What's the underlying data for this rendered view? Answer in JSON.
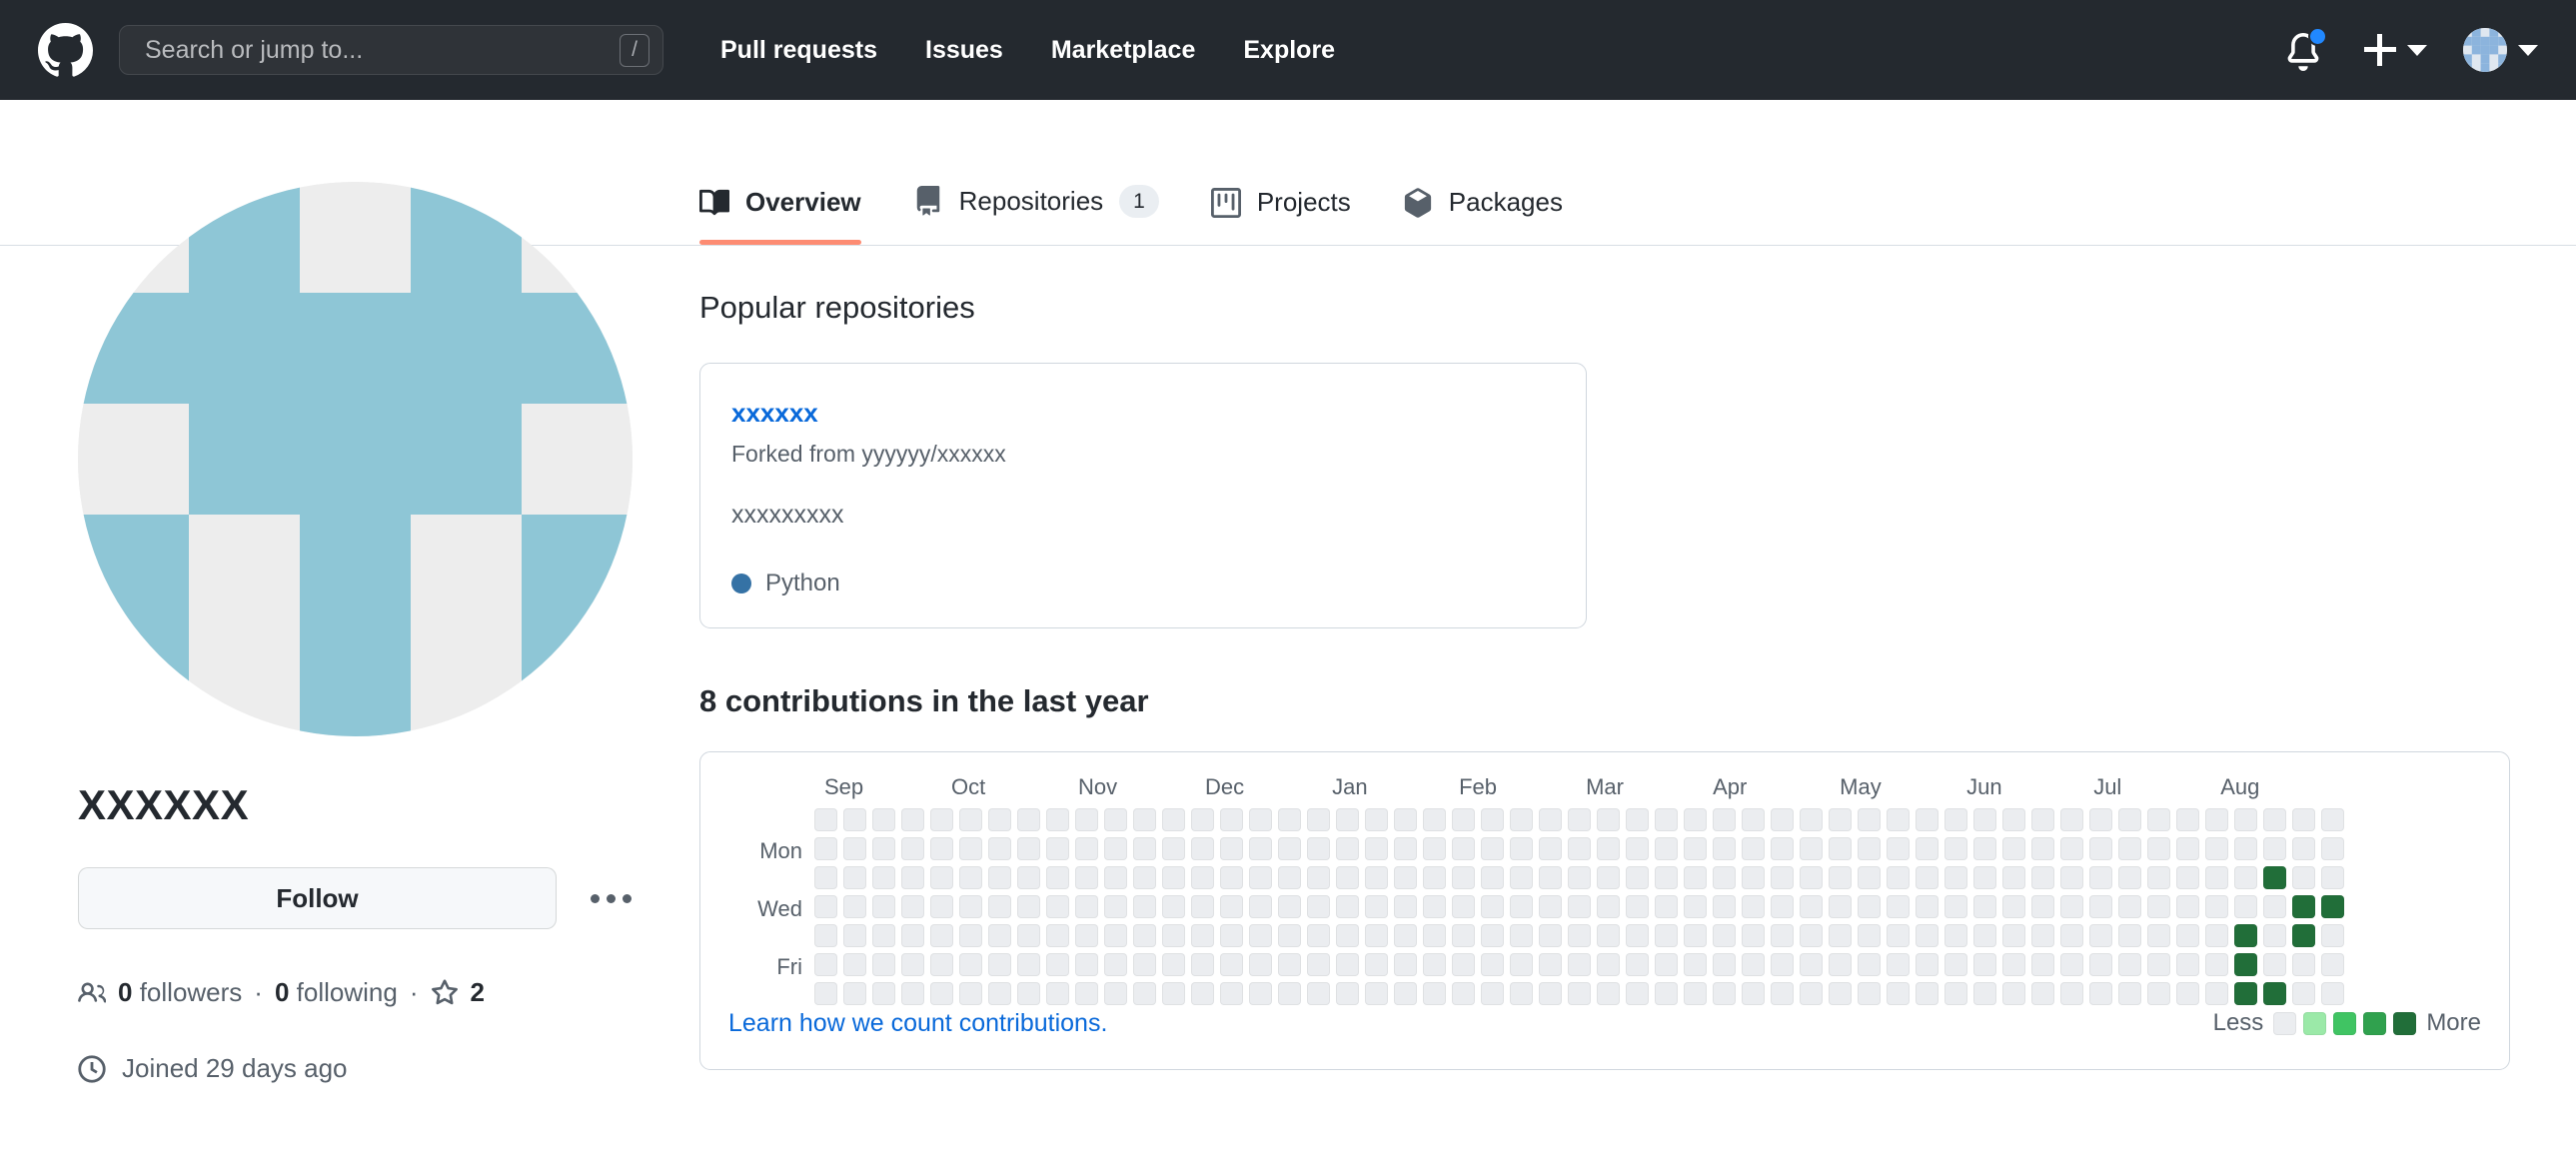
{
  "header": {
    "logo_icon": "github-logo-icon",
    "search": {
      "placeholder": "Search or jump to...",
      "shortcut_key": "/"
    },
    "nav_links": [
      {
        "label": "Pull requests"
      },
      {
        "label": "Issues"
      },
      {
        "label": "Marketplace"
      },
      {
        "label": "Explore"
      }
    ],
    "notifications": {
      "icon": "bell-icon",
      "has_unread": true,
      "dot_color": "#2188ff"
    },
    "create_new": {
      "icon": "plus-icon",
      "caret": "chevron-down-icon"
    },
    "account": {
      "icon": "avatar",
      "caret": "chevron-down-icon"
    },
    "background_color": "#24292f"
  },
  "profile": {
    "avatar_name": "user-avatar-identicon",
    "avatar_bg": "#ededed",
    "avatar_fg": "#8ec6d6",
    "identicon_pattern": [
      [
        0,
        1,
        0,
        1,
        0
      ],
      [
        1,
        1,
        1,
        1,
        1
      ],
      [
        0,
        1,
        1,
        1,
        0
      ],
      [
        1,
        0,
        1,
        0,
        1
      ],
      [
        1,
        0,
        1,
        0,
        1
      ]
    ],
    "name": "XXXXXX",
    "follow_label": "Follow",
    "more_options_label": "...",
    "followers_count": "0",
    "followers_label": "followers",
    "following_count": "0",
    "following_label": "following",
    "stars_count": "2",
    "joined_text": "Joined 29 days ago",
    "separator": "·"
  },
  "tabs": [
    {
      "label": "Overview",
      "icon": "book-icon",
      "active": true,
      "count": null
    },
    {
      "label": "Repositories",
      "icon": "repo-icon",
      "active": false,
      "count": "1"
    },
    {
      "label": "Projects",
      "icon": "project-icon",
      "active": false,
      "count": null
    },
    {
      "label": "Packages",
      "icon": "package-icon",
      "active": false,
      "count": null
    }
  ],
  "active_tab_indicator_color": "#fd8c73",
  "popular_repositories": {
    "title": "Popular repositories",
    "items": [
      {
        "name": "xxxxxx",
        "forked_from": "Forked from yyyyyy/xxxxxx",
        "description": "xxxxxxxxx",
        "language": "Python",
        "language_color": "#3572A5"
      }
    ]
  },
  "contributions": {
    "title": "8 contributions in the last year",
    "total": 8,
    "months": [
      "Sep",
      "Oct",
      "Nov",
      "Dec",
      "Jan",
      "Feb",
      "Mar",
      "Apr",
      "May",
      "Jun",
      "Jul",
      "Aug"
    ],
    "day_labels": [
      "Mon",
      "Wed",
      "Fri"
    ],
    "weeks": 53,
    "days_per_week": 7,
    "empty_color": "#ebedf0",
    "active_color": "#216e39",
    "active_cells": [
      {
        "week": 49,
        "day": 4
      },
      {
        "week": 49,
        "day": 5
      },
      {
        "week": 49,
        "day": 6
      },
      {
        "week": 51,
        "day": 3
      },
      {
        "week": 51,
        "day": 4
      },
      {
        "week": 52,
        "day": 3
      },
      {
        "week": 50,
        "day": 2
      },
      {
        "week": 50,
        "day": 6
      }
    ],
    "footer_link": "Learn how we count contributions.",
    "legend_less": "Less",
    "legend_more": "More",
    "legend_colors": [
      "#ebedf0",
      "#9be9a8",
      "#40c463",
      "#30a14e",
      "#216e39"
    ]
  }
}
